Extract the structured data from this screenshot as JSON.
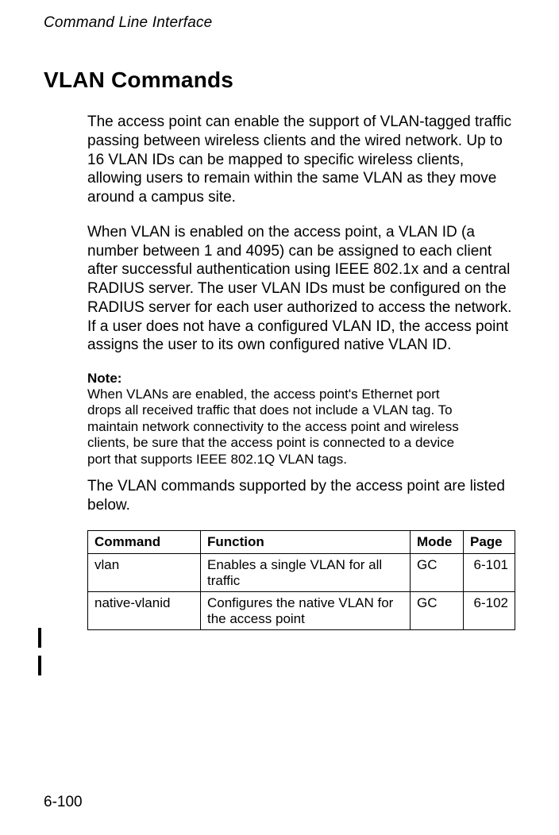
{
  "running_header": "Command Line Interface",
  "section_title": "VLAN Commands",
  "para1": "The access point can enable the support of VLAN-tagged traffic passing between wireless clients and the wired network. Up to 16 VLAN IDs can be mapped to specific wireless clients, allowing users to remain within the same VLAN as they move around a campus site.",
  "para2": "When VLAN is enabled on the access point, a VLAN ID (a number between 1 and 4095) can be assigned to each client after successful authentication using IEEE 802.1x and a central RADIUS server. The user VLAN IDs must be configured on the RADIUS server for each user authorized to access the network. If a user does not have a configured VLAN ID, the access point assigns the user to its own configured native VLAN ID.",
  "note_label": "Note:",
  "note_text": "When VLANs are enabled, the access point's Ethernet port drops all received traffic that does not include a VLAN tag. To maintain network connectivity to the access point and wireless clients, be sure that the access point is connected to a device port that supports IEEE 802.1Q VLAN tags.",
  "para3": "The VLAN commands supported by the access point are listed below.",
  "table": {
    "headers": {
      "command": "Command",
      "function": "Function",
      "mode": "Mode",
      "page": "Page"
    },
    "rows": [
      {
        "command": "vlan",
        "function": "Enables a single VLAN for all traffic",
        "mode": "GC",
        "page": "6-101"
      },
      {
        "command": "native-vlanid",
        "function": "Configures the native VLAN for the access point",
        "mode": "GC",
        "page": "6-102"
      }
    ]
  },
  "page_number": "6-100"
}
